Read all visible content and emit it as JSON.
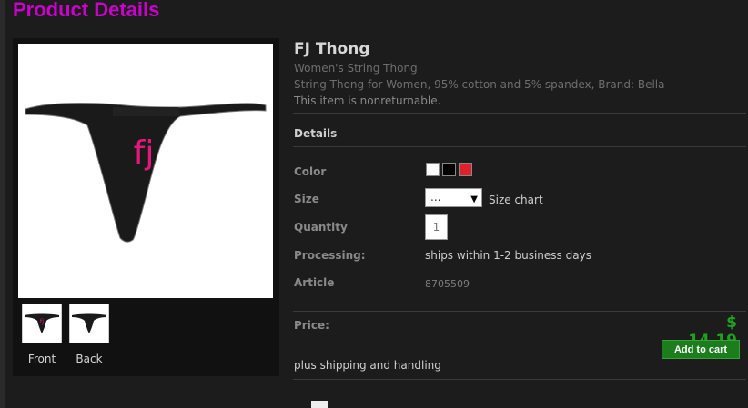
{
  "page": {
    "title": "Product Details"
  },
  "product": {
    "name": "FJ Thong",
    "subtitle": "Women's String Thong",
    "description": "String Thong for Women, 95% cotton and 5% spandex, Brand: Bella",
    "note": "This item is nonreturnable.",
    "image_text": "fj",
    "accent_color": "#e0197a"
  },
  "gallery": {
    "thumbs": [
      {
        "label": "Front"
      },
      {
        "label": "Back"
      }
    ]
  },
  "details": {
    "section_title": "Details",
    "color_label": "Color",
    "colors": [
      "#ffffff",
      "#000000",
      "#e0202a"
    ],
    "size_label": "Size",
    "size_value": "...",
    "size_chart": "Size chart",
    "quantity_label": "Quantity",
    "quantity_value": "1",
    "processing_label": "Processing:",
    "processing_value": "ships within 1-2 business days",
    "article_label": "Article",
    "article_value": "8705509"
  },
  "pricing": {
    "price_label": "Price:",
    "price": "$ 14.19",
    "add_to_cart": "Add to cart",
    "shipping_note": "plus shipping and handling"
  }
}
